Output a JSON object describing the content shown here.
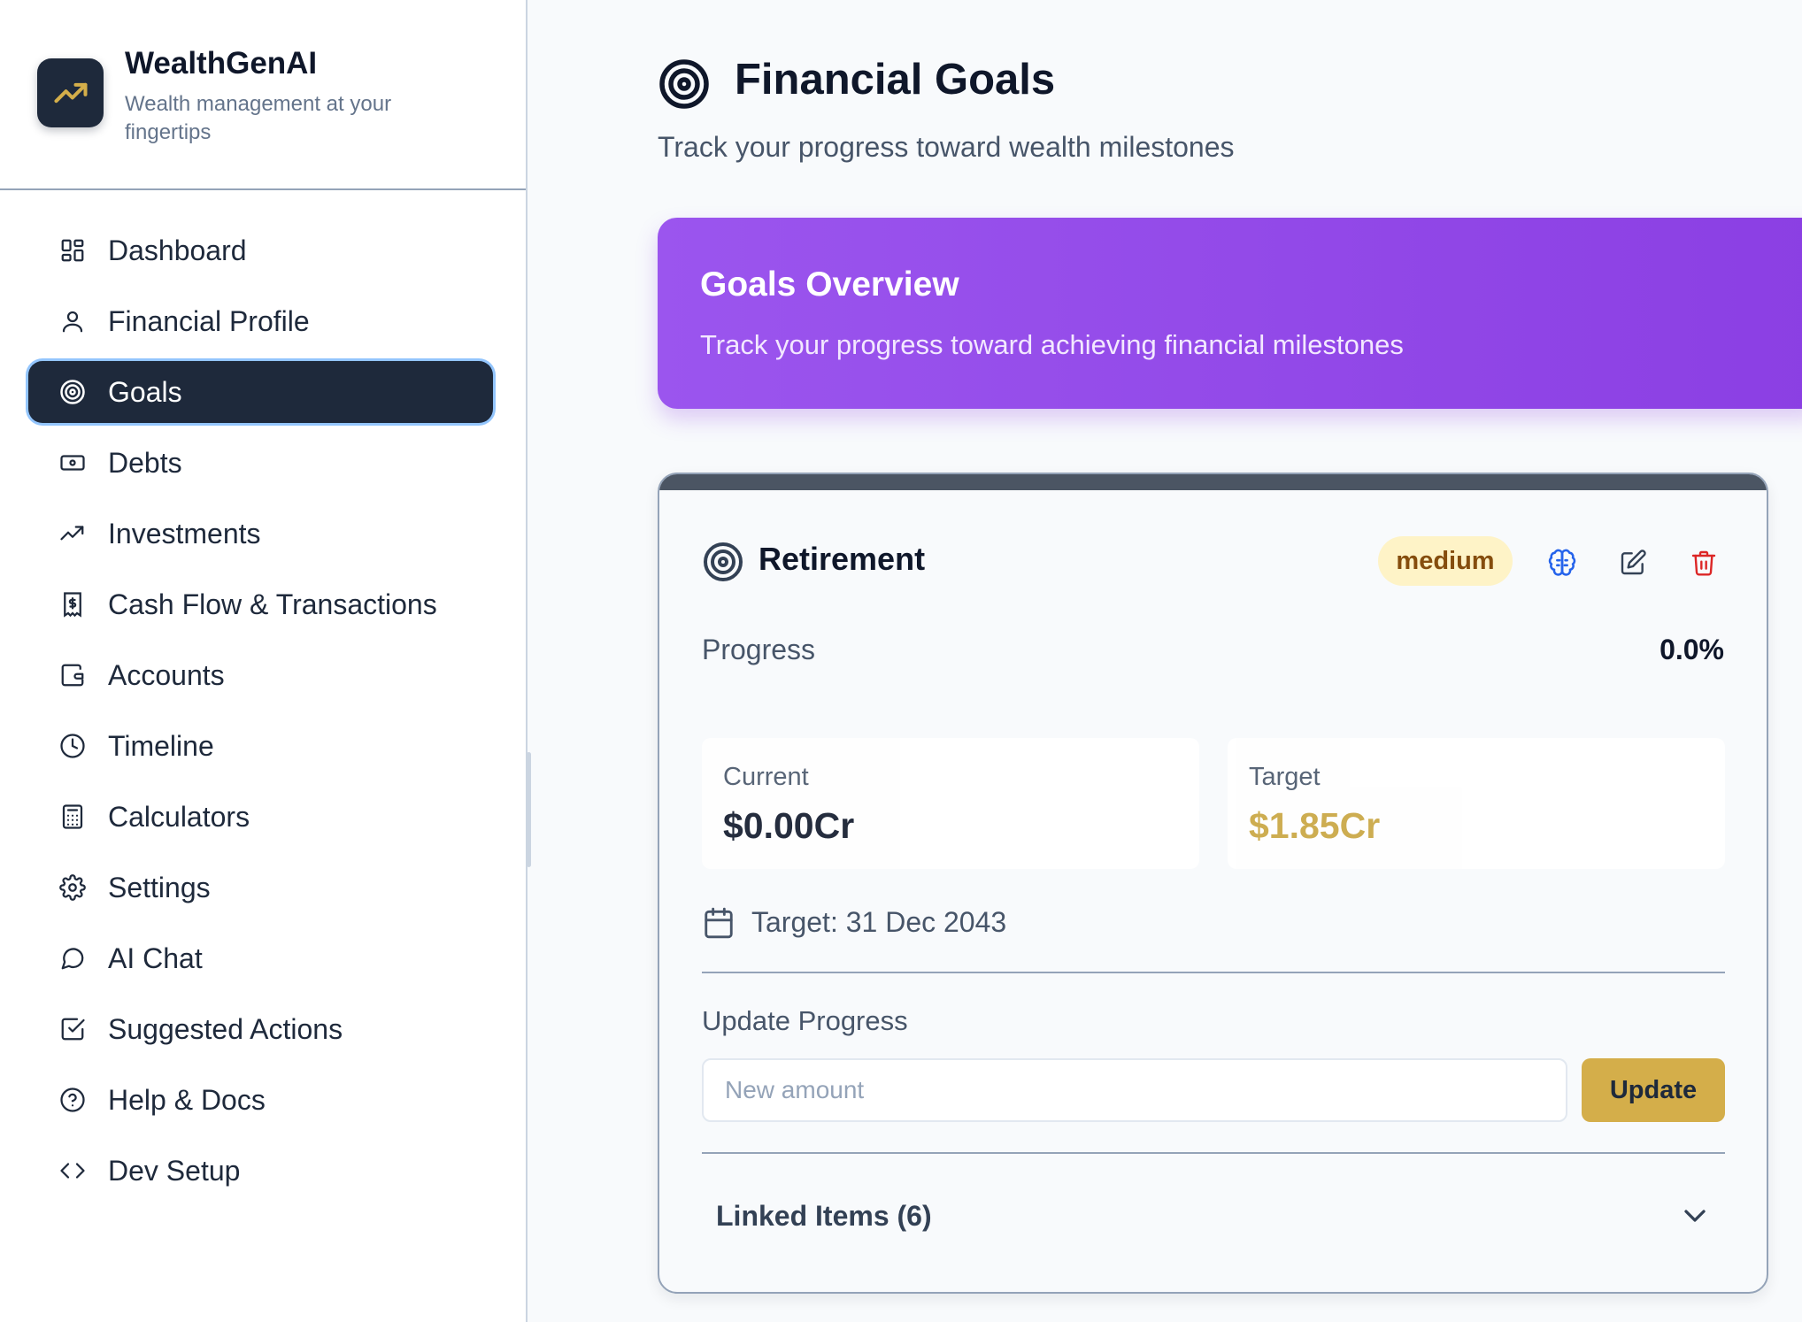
{
  "brand": {
    "title": "WealthGenAI",
    "subtitle": "Wealth management at your fingertips"
  },
  "nav": {
    "items": [
      {
        "label": "Dashboard",
        "icon": "dashboard-grid-icon"
      },
      {
        "label": "Financial Profile",
        "icon": "user-icon"
      },
      {
        "label": "Goals",
        "icon": "target-icon",
        "active": true
      },
      {
        "label": "Debts",
        "icon": "banknote-icon"
      },
      {
        "label": "Investments",
        "icon": "trending-up-icon"
      },
      {
        "label": "Cash Flow & Transactions",
        "icon": "receipt-icon"
      },
      {
        "label": "Accounts",
        "icon": "wallet-icon"
      },
      {
        "label": "Timeline",
        "icon": "clock-icon"
      },
      {
        "label": "Calculators",
        "icon": "calculator-icon"
      },
      {
        "label": "Settings",
        "icon": "gear-icon"
      },
      {
        "label": "AI Chat",
        "icon": "chat-bubble-icon"
      },
      {
        "label": "Suggested Actions",
        "icon": "check-square-icon"
      },
      {
        "label": "Help & Docs",
        "icon": "help-circle-icon"
      },
      {
        "label": "Dev Setup",
        "icon": "code-icon"
      }
    ]
  },
  "page": {
    "title": "Financial Goals",
    "subtitle": "Track your progress toward wealth milestones"
  },
  "overview": {
    "title": "Goals Overview",
    "subtitle": "Track your progress toward achieving financial milestones"
  },
  "goal": {
    "name": "Retirement",
    "priority": "medium",
    "progress_label": "Progress",
    "progress_value": "0.0%",
    "current_label": "Current",
    "current_value": "$0.00Cr",
    "target_label": "Target",
    "target_value": "$1.85Cr",
    "target_date": "Target: 31 Dec 2043",
    "update_label": "Update Progress",
    "input_placeholder": "New amount",
    "update_button": "Update",
    "linked_items": "Linked Items (6)"
  },
  "colors": {
    "sidebar_active": "#1e293b",
    "overview_gradient_start": "#9b55ee",
    "overview_gradient_end": "#8b3fe3",
    "gold_accent": "#d4ae4a",
    "target_value": "#c9a53f",
    "priority_bg": "#fef3c7",
    "priority_text": "#854d0e",
    "brain_icon": "#2563eb",
    "delete_icon": "#dc2626"
  }
}
